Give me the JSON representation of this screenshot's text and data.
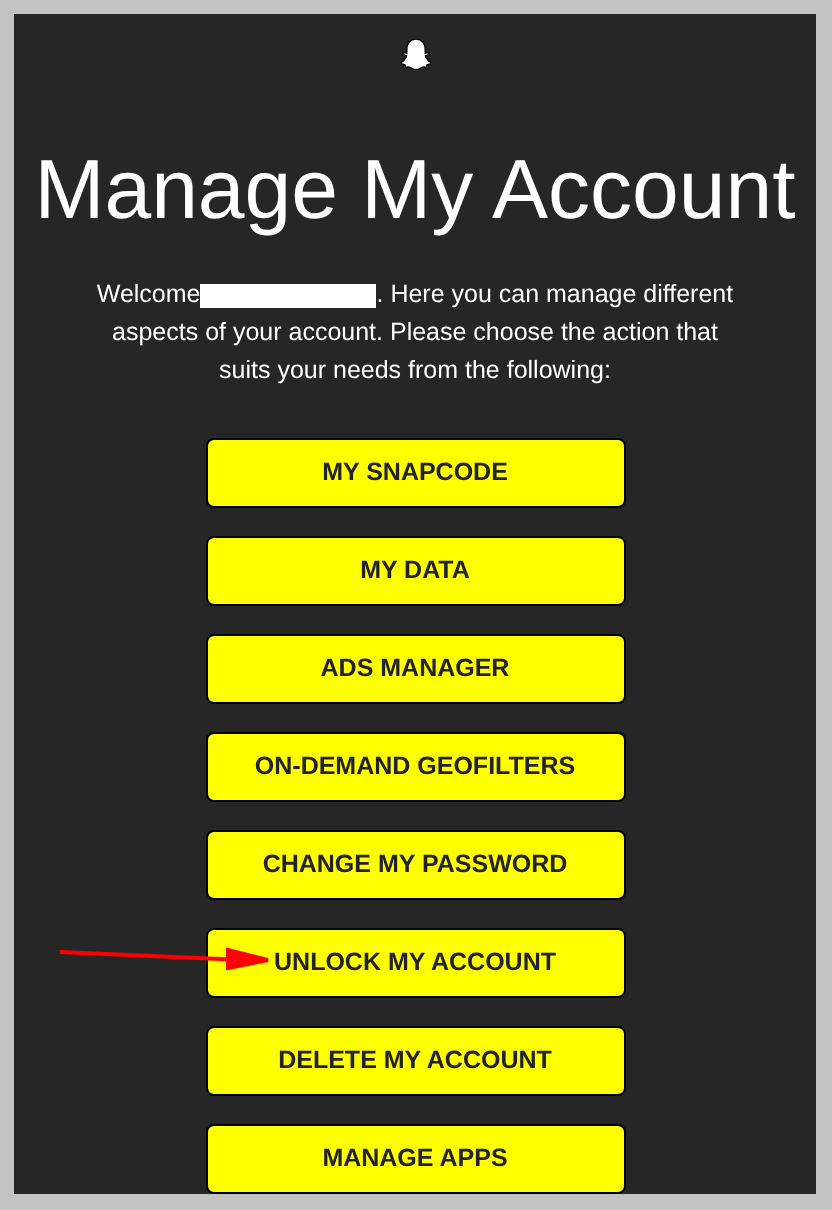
{
  "title": "Manage My Account",
  "welcome": {
    "before": "Welcome",
    "name_redacted": true,
    "after": ". Here you can manage different aspects of your account. Please choose the action that suits your needs from the following:"
  },
  "buttons": [
    {
      "label": "MY SNAPCODE",
      "arrow": false
    },
    {
      "label": "MY DATA",
      "arrow": false
    },
    {
      "label": "ADS MANAGER",
      "arrow": false
    },
    {
      "label": "ON-DEMAND GEOFILTERS",
      "arrow": false
    },
    {
      "label": "CHANGE MY PASSWORD",
      "arrow": false
    },
    {
      "label": "UNLOCK MY ACCOUNT",
      "arrow": true
    },
    {
      "label": "DELETE MY ACCOUNT",
      "arrow": false
    },
    {
      "label": "MANAGE APPS",
      "arrow": false
    }
  ]
}
